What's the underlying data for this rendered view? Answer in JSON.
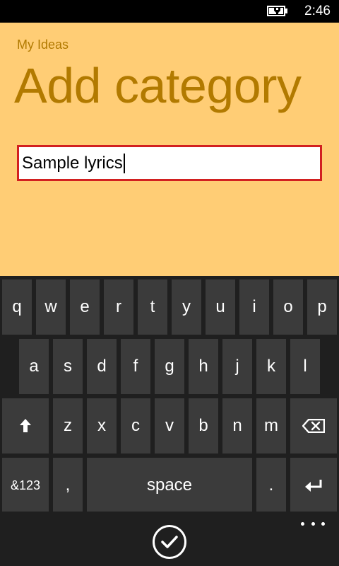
{
  "status_bar": {
    "time": "2:46",
    "battery_icon": "battery-charging-icon"
  },
  "app": {
    "app_name": "My Ideas",
    "page_title": "Add category",
    "input": {
      "value": "Sample lyrics"
    }
  },
  "keyboard": {
    "row1": [
      "q",
      "w",
      "e",
      "r",
      "t",
      "y",
      "u",
      "i",
      "o",
      "p"
    ],
    "row2": [
      "a",
      "s",
      "d",
      "f",
      "g",
      "h",
      "j",
      "k",
      "l"
    ],
    "row3": [
      "z",
      "x",
      "c",
      "v",
      "b",
      "n",
      "m"
    ],
    "shift_icon": "shift-arrow-icon",
    "backspace_icon": "backspace-icon",
    "symbols_label": "&123",
    "comma_label": ",",
    "space_label": "space",
    "period_label": ".",
    "enter_icon": "enter-icon"
  },
  "app_bar": {
    "confirm_icon": "check-circle-icon",
    "more_icon": "ellipsis-icon"
  },
  "colors": {
    "app_background": "#ffcd75",
    "accent_text": "#b27a00",
    "input_border": "#d22020",
    "key_background": "#3b3b3b",
    "keyboard_background": "#1f1f1f"
  }
}
